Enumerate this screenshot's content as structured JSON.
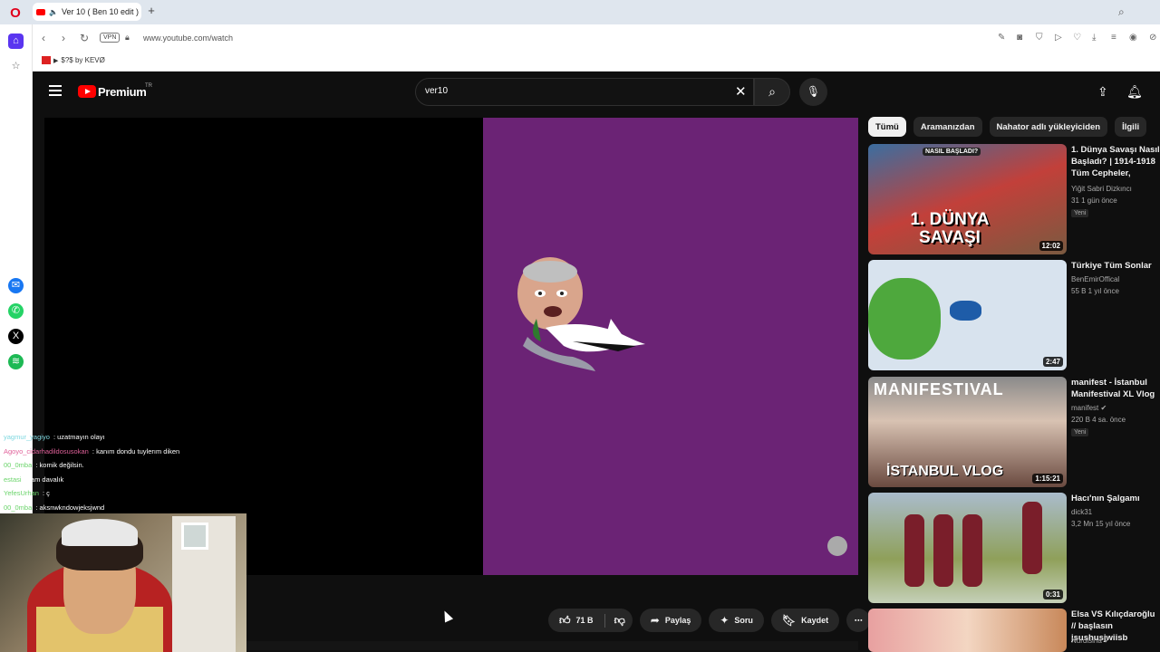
{
  "browser": {
    "tab_title": "Ver 10 ( Ben 10 edit )",
    "url": "www.youtube.com/watch",
    "vpn_label": "VPN",
    "bookmark_label": "$?$ by KEVØ"
  },
  "youtube": {
    "logo_text": "Premium",
    "country": "TR",
    "search_value": "ver10"
  },
  "chat": [
    {
      "user": "yagmur_yagiyo",
      "text": " : uzatmayın olayı",
      "color": "#7fd8e0"
    },
    {
      "user": "Agoyo_cidarhadildosusokan",
      "text": " : kanım dondu tuylerım diken",
      "color": "#e0619a"
    },
    {
      "user": "00_0mba",
      "text": " : komik değilsin.",
      "color": "#6bd46b"
    },
    {
      "user": "estasi",
      "text": " : tam davalık",
      "color": "#6bd46b"
    },
    {
      "user": "YefesUrhan",
      "text": " : ç",
      "color": "#6bd46b"
    },
    {
      "user": "00_0mba",
      "text": " : aksnwkndowjeksjwnd",
      "color": "#6bd46b"
    }
  ],
  "actions": {
    "like_count": "71 B",
    "share": "Paylaş",
    "ask": "Soru",
    "save": "Kaydet"
  },
  "chips": [
    "Tümü",
    "Aramanızdan",
    "Nahator adlı yükleyiciden",
    "İlgili"
  ],
  "recommended": [
    {
      "title": "1. Dünya Savaşı Nasıl Başladı? | 1914-1918 Tüm Cepheler, Çanakkale ve",
      "channel": "Yiğit Sabri Dizkıncı",
      "meta": "31   1 gün önce",
      "badge": "Yeni",
      "duration": "12:02"
    },
    {
      "title": "Türkiye Tüm Sonlar",
      "channel": "BenEmirOffical",
      "meta": "55 B   1 yıl önce",
      "badge": "",
      "duration": "2:47"
    },
    {
      "title": "manifest - İstanbul Manifestival XL Vlog",
      "channel": "manifest",
      "meta": "220 B   4 sa. önce",
      "badge": "Yeni",
      "duration": "1:15:21"
    },
    {
      "title": "Hacı'nın Şalgamı",
      "channel": "dick31",
      "meta": "3,2 Mn   15 yıl önce",
      "badge": "",
      "duration": "0:31"
    },
    {
      "title": "Elsa VS Kılıçdaroğlu // başlasın jsushusjwiisb",
      "channel": "Nurdisina",
      "meta": "",
      "badge": "",
      "duration": ""
    }
  ],
  "thumb_text": {
    "ww1_big": "1. DÜNYA SAVAŞI",
    "ww1_top": "NASIL BAŞLADI?",
    "manifest_top": "MANIFESTIVAL",
    "manifest_bottom": "İSTANBUL VLOG"
  }
}
